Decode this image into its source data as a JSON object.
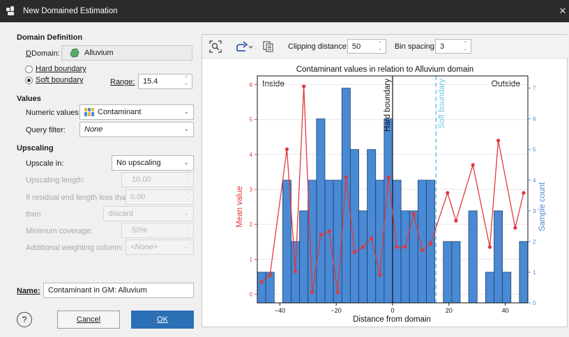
{
  "window": {
    "title": "New Domained Estimation",
    "close": "✕"
  },
  "domain_definition": {
    "heading": "Domain Definition",
    "domain_label": "Domain:",
    "domain_value": "Alluvium",
    "hard_label": "Hard boundary",
    "soft_label": "Soft boundary",
    "selected": "soft",
    "range_label": "Range:",
    "range_value": "15.4"
  },
  "values": {
    "heading": "Values",
    "numeric_label": "Numeric values:",
    "numeric_value": "Contaminant",
    "query_label": "Query filter:",
    "query_value": "None"
  },
  "upscaling": {
    "heading": "Upscaling",
    "upscale_label": "Upscale in:",
    "upscale_value": "No upscaling",
    "length_label": "Upscaling length:",
    "length_value": "10.00",
    "residual_label": "If residual end length less than:",
    "residual_value": "0.00",
    "then_label": "then",
    "then_value": "discard",
    "coverage_label": "Minimum coverage:",
    "coverage_value": "50%",
    "weighting_label": "Additional weighting column:",
    "weighting_value": "<None>"
  },
  "name": {
    "label": "Name:",
    "value": "Contaminant in GM: Alluvium"
  },
  "buttons": {
    "help": "?",
    "cancel": "Cancel",
    "ok": "OK"
  },
  "toolbar": {
    "clipping_label": "Clipping distance:",
    "clipping_value": "50",
    "bin_label": "Bin spacing:",
    "bin_value": "3"
  },
  "chart_data": {
    "type": "bar+line",
    "title": "Contaminant values in relation to Alluvium domain",
    "xlabel": "Distance from domain",
    "ylabel_left": "Mean value",
    "ylabel_right": "Sample count",
    "xlim": [
      -48,
      48
    ],
    "ylim_left": [
      -0.25,
      6.25
    ],
    "ylim_right": [
      0,
      7.4
    ],
    "x_ticks": [
      -40,
      -20,
      0,
      20,
      40
    ],
    "y_left_ticks": [
      0,
      1,
      2,
      3,
      4,
      5,
      6
    ],
    "y_right_ticks": [
      0,
      1,
      2,
      3,
      4,
      5,
      6,
      7
    ],
    "inside_label": "Inside",
    "outside_label": "Outside",
    "hard_boundary": {
      "x": 0,
      "label": "Hard boundary"
    },
    "soft_boundary": {
      "x": 15.4,
      "label": "Soft boundary"
    },
    "bar_color": "#4a89d4",
    "line_color": "#e0383c",
    "soft_color": "#6cc6e0",
    "bars": [
      {
        "x0": -48,
        "x1": -45,
        "count": 1
      },
      {
        "x0": -45,
        "x1": -42,
        "count": 1
      },
      {
        "x0": -39,
        "x1": -36,
        "count": 4
      },
      {
        "x0": -36,
        "x1": -33,
        "count": 2
      },
      {
        "x0": -33,
        "x1": -30,
        "count": 3
      },
      {
        "x0": -30,
        "x1": -27,
        "count": 4
      },
      {
        "x0": -27,
        "x1": -24,
        "count": 6
      },
      {
        "x0": -24,
        "x1": -21,
        "count": 4
      },
      {
        "x0": -21,
        "x1": -18,
        "count": 4
      },
      {
        "x0": -18,
        "x1": -15,
        "count": 7
      },
      {
        "x0": -15,
        "x1": -12,
        "count": 5
      },
      {
        "x0": -12,
        "x1": -9,
        "count": 3
      },
      {
        "x0": -9,
        "x1": -6,
        "count": 5
      },
      {
        "x0": -6,
        "x1": -3,
        "count": 4
      },
      {
        "x0": -3,
        "x1": 0,
        "count": 6
      },
      {
        "x0": 0,
        "x1": 3,
        "count": 4
      },
      {
        "x0": 3,
        "x1": 6,
        "count": 3
      },
      {
        "x0": 6,
        "x1": 9,
        "count": 3
      },
      {
        "x0": 9,
        "x1": 12,
        "count": 4
      },
      {
        "x0": 12,
        "x1": 15,
        "count": 4
      },
      {
        "x0": 18,
        "x1": 21,
        "count": 2
      },
      {
        "x0": 21,
        "x1": 24,
        "count": 2
      },
      {
        "x0": 27,
        "x1": 30,
        "count": 3
      },
      {
        "x0": 33,
        "x1": 36,
        "count": 1
      },
      {
        "x0": 36,
        "x1": 39,
        "count": 3
      },
      {
        "x0": 39,
        "x1": 42,
        "count": 1
      },
      {
        "x0": 45,
        "x1": 48,
        "count": 2
      }
    ],
    "line": {
      "x": [
        -46.5,
        -43.5,
        -37.5,
        -34.5,
        -31.5,
        -28.5,
        -25.5,
        -22.5,
        -19.5,
        -16.5,
        -13.5,
        -10.5,
        -7.5,
        -4.5,
        -1.5,
        1.5,
        4.5,
        7.5,
        10.5,
        13.5,
        19.5,
        22.5,
        28.5,
        34.5,
        37.5,
        43.5,
        46.5
      ],
      "y": [
        0.35,
        0.55,
        4.15,
        0.65,
        5.95,
        0.05,
        1.7,
        1.8,
        0.05,
        3.35,
        1.2,
        1.35,
        1.6,
        0.55,
        3.35,
        1.35,
        1.35,
        2.3,
        1.25,
        1.45,
        2.9,
        2.1,
        3.7,
        1.35,
        4.4,
        1.9,
        2.9
      ]
    }
  }
}
